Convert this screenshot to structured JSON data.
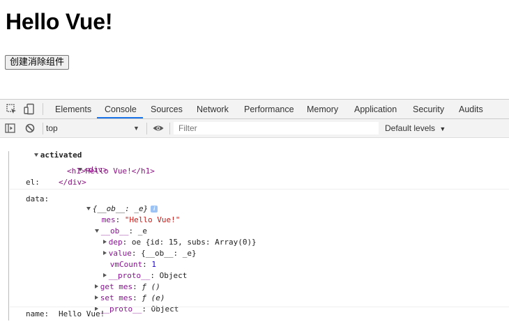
{
  "page": {
    "heading": "Hello Vue!",
    "button_label": "创建消除组件"
  },
  "devtools": {
    "tabs": [
      {
        "label": "Elements"
      },
      {
        "label": "Console"
      },
      {
        "label": "Sources"
      },
      {
        "label": "Network"
      },
      {
        "label": "Performance"
      },
      {
        "label": "Memory"
      },
      {
        "label": "Application"
      },
      {
        "label": "Security"
      },
      {
        "label": "Audits"
      }
    ],
    "active_tab": "Console",
    "accent_color": "#1a73e8",
    "console_bar": {
      "context": "top",
      "filter_placeholder": "Filter",
      "levels_label": "Default levels"
    },
    "output": {
      "group_label": "activated",
      "el": {
        "key": "el:",
        "div_open": "<div>",
        "h1_line": "<h1>Hello Vue!</h1>",
        "div_close": "</div>"
      },
      "data": {
        "key": "data:",
        "preview": "{__ob__: _e}",
        "mes_key": "mes",
        "mes_val": "\"Hello Vue!\"",
        "ob_key": "__ob__",
        "ob_val": "_e",
        "dep_key": "dep",
        "dep_val": "oe {id: 15, subs: Array(0)}",
        "value_key": "value",
        "value_val": "{__ob__: _e}",
        "vmcount_key": "vmCount",
        "vmcount_val": "1",
        "proto1_key": "__proto__",
        "proto1_val": "Object",
        "get_mes_key": "get mes",
        "get_mes_val": "ƒ ()",
        "set_mes_key": "set mes",
        "set_mes_val": "ƒ (e)",
        "proto2_key": "__proto__",
        "proto2_val": "Object"
      },
      "name": {
        "key": "name:",
        "value": "Hello Vue!"
      }
    }
  }
}
